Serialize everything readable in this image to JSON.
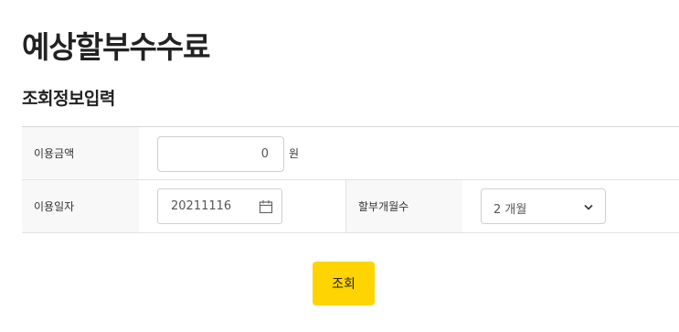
{
  "page": {
    "title": "예상할부수수료",
    "section_title": "조회정보입력"
  },
  "form": {
    "amount": {
      "label": "이용금액",
      "value": "0",
      "unit": "원"
    },
    "date": {
      "label": "이용일자",
      "value": "20211116"
    },
    "installment": {
      "label": "할부개월수",
      "selected": "2 개월"
    }
  },
  "actions": {
    "submit_label": "조회"
  },
  "colors": {
    "accent": "#ffd400",
    "label_bg": "#f8f8f8",
    "border": "#cfcfcf"
  },
  "icons": {
    "date": "calendar-icon",
    "select": "chevron-down-icon"
  }
}
